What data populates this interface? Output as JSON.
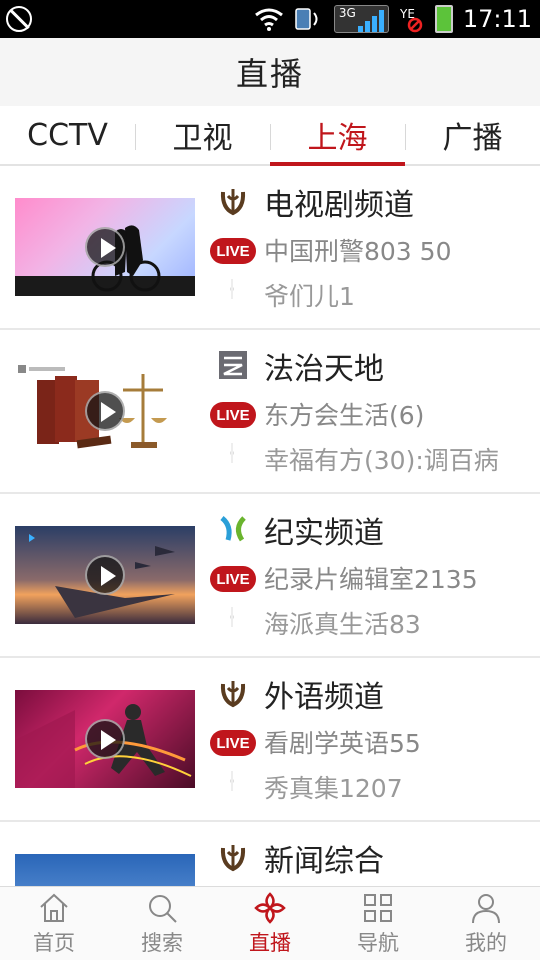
{
  "status": {
    "time": "17:11",
    "network": "3G"
  },
  "header": {
    "title": "直播"
  },
  "tabs": [
    {
      "label": "CCTV",
      "active": false
    },
    {
      "label": "卫视",
      "active": false
    },
    {
      "label": "上海",
      "active": true
    },
    {
      "label": "广播",
      "active": false
    }
  ],
  "channels": [
    {
      "name": "电视剧频道",
      "live_badge": "LIVE",
      "now": "中国刑警803 50",
      "next": "爷们儿1",
      "logo": "dragon-logo-icon"
    },
    {
      "name": "法治天地",
      "live_badge": "LIVE",
      "now": "东方会生活(6)",
      "next": "幸福有方(30):调百病",
      "logo": "fazhi-logo-icon"
    },
    {
      "name": "纪实频道",
      "live_badge": "LIVE",
      "now": "纪录片编辑室2135",
      "next": "海派真生活83",
      "logo": "jishi-logo-icon"
    },
    {
      "name": "外语频道",
      "live_badge": "LIVE",
      "now": "看剧学英语55",
      "next": "秀真集1207",
      "logo": "dragon-logo-icon"
    },
    {
      "name": "新闻综合",
      "logo": "dragon-logo-icon"
    }
  ],
  "bottom_nav": [
    {
      "label": "首页",
      "icon": "home-icon",
      "active": false
    },
    {
      "label": "搜索",
      "icon": "search-icon",
      "active": false
    },
    {
      "label": "直播",
      "icon": "live-knot-icon",
      "active": true
    },
    {
      "label": "导航",
      "icon": "grid-icon",
      "active": false
    },
    {
      "label": "我的",
      "icon": "user-icon",
      "active": false
    }
  ],
  "colors": {
    "accent": "#c0161c",
    "text": "#222222",
    "muted": "#888888"
  }
}
